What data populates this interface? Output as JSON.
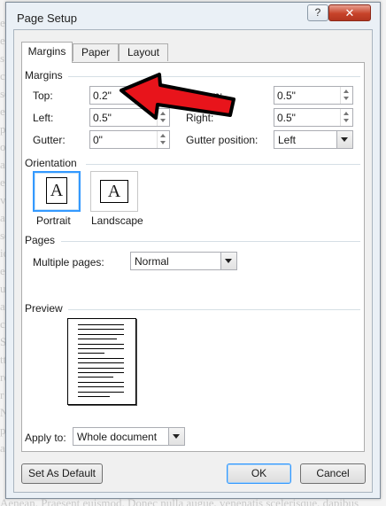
{
  "window": {
    "title": "Page Setup",
    "help_label": "?",
    "close_label": "✕"
  },
  "tabs": [
    {
      "label": "Margins",
      "active": true
    },
    {
      "label": "Paper",
      "active": false
    },
    {
      "label": "Layout",
      "active": false
    }
  ],
  "margins": {
    "group_label": "Margins",
    "top": {
      "label": "Top:",
      "value": "0.2\""
    },
    "bottom": {
      "label": "Bottom:",
      "value": "0.5\""
    },
    "left": {
      "label": "Left:",
      "value": "0.5\""
    },
    "right": {
      "label": "Right:",
      "value": "0.5\""
    },
    "gutter": {
      "label": "Gutter:",
      "value": "0\""
    },
    "gutter_position": {
      "label": "Gutter position:",
      "value": "Left"
    }
  },
  "orientation": {
    "group_label": "Orientation",
    "portrait_label": "Portrait",
    "landscape_label": "Landscape",
    "glyph": "A",
    "selected": "portrait"
  },
  "pages": {
    "group_label": "Pages",
    "multiple_label": "Multiple pages:",
    "multiple_value": "Normal"
  },
  "preview": {
    "group_label": "Preview"
  },
  "apply_to": {
    "label": "Apply to:",
    "value": "Whole document"
  },
  "buttons": {
    "set_default": "Set As Default",
    "ok": "OK",
    "cancel": "Cancel"
  },
  "annotation": {
    "color": "#e8141b",
    "icon": "red-arrow-icon"
  },
  "background_text": {
    "left_fragments": [
      "e",
      "ec",
      "s",
      "c",
      "se",
      "eu",
      "pe",
      "oe",
      "a.",
      "ec",
      "ve",
      "a",
      "se",
      "ic",
      "e",
      "u",
      "ae",
      "co",
      "Se",
      "tt",
      "ro",
      "r",
      "Nu",
      "pu",
      "ac"
    ],
    "right_fragments": [
      "p",
      "e",
      "e",
      "s",
      "e",
      "a",
      "o",
      "d",
      "c",
      "e",
      "e",
      "p",
      "e",
      "c",
      "s",
      "a",
      "e",
      "u",
      "p",
      "s",
      "e",
      "c"
    ],
    "bottom_line": "Aenean. Praesent euismod. Donec nulla augue, venenatis scelerisque, dapibus"
  }
}
